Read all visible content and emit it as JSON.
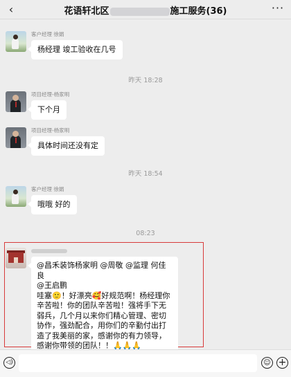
{
  "header": {
    "title_left": "花语轩北区",
    "title_right": "施工服务(36)",
    "back_icon": "chevron-left-icon",
    "more_icon": "more-dots-icon"
  },
  "timestamps": [
    "昨天 18:28",
    "昨天 18:54",
    "08:23"
  ],
  "messages": [
    {
      "sender": "客户经理 徐娟",
      "text": "杨经理  竣工验收在几号",
      "avatar": "customer-avatar"
    },
    {
      "sender": "项目经理-杨家明",
      "text": "下个月",
      "avatar": "manager-avatar"
    },
    {
      "sender": "项目经理-杨家明",
      "text": "具体时间还没有定",
      "avatar": "manager-avatar"
    },
    {
      "sender": "客户经理 徐娟",
      "text": "哦哦  好的",
      "avatar": "customer-avatar"
    }
  ],
  "highlighted_message": {
    "lines": [
      "@昌禾装饰杨家明 @周敬 @监理 何佳良",
      "@王启鹏",
      "哇塞🙂！好漂亮🥰好规范啊！杨经理你辛苦啦！你的团队辛苦啦！强将手下无弱兵，几个月以来你们精心管理、密切协作，强劲配合，用你们的辛勤付出打造了我美丽的家，感谢你的有力领导，感谢你带领的团队！！🙏🙏🙏"
    ]
  },
  "input_bar": {
    "voice_icon": "voice-icon",
    "emoji_icon": "emoji-icon",
    "plus_icon": "plus-icon",
    "voice_glyph": "◁)",
    "emoji_glyph": "☺",
    "plus_glyph": "+"
  },
  "colors": {
    "highlight_border": "#d83a3a",
    "background": "#ededed"
  }
}
